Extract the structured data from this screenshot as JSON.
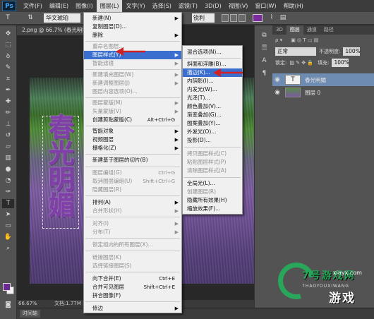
{
  "app": {
    "logo": "Ps"
  },
  "menubar": [
    "文件(F)",
    "编辑(E)",
    "图像(I)",
    "图层(L)",
    "文字(Y)",
    "选择(S)",
    "滤镜(T)",
    "3D(D)",
    "视图(V)",
    "窗口(W)",
    "帮助(H)"
  ],
  "options": {
    "font_family": "华文琥珀",
    "antialias": "锐利"
  },
  "document": {
    "tab_title": "2.png @ 66.7% (春光明媚, RGB/8) *",
    "zoom": "66.67%",
    "doc_info": "文档:1.77M",
    "canvas_text": "春光明媚"
  },
  "timeline": {
    "label": "时间轴"
  },
  "layers_panel": {
    "tabs": [
      "3D",
      "图层",
      "通道",
      "路径"
    ],
    "blend_mode": "正常",
    "opacity_label": "不透明度:",
    "opacity_value": "100%",
    "lock_label": "锁定:",
    "fill_label": "填充:",
    "fill_value": "100%",
    "layers": [
      {
        "name": "春光明媚",
        "thumb": "T"
      },
      {
        "name": "图层 0",
        "thumb": ""
      }
    ]
  },
  "layer_menu": {
    "items": [
      {
        "label": "新建(N)",
        "sub": true
      },
      {
        "label": "复制图层(D)..."
      },
      {
        "label": "删除",
        "sub": true
      },
      {
        "label": "重命名图层...",
        "disabled": true
      },
      {
        "label": "图层样式(Y)",
        "sub": true,
        "highlight": true
      },
      {
        "label": "智能滤镜",
        "sub": true,
        "disabled": true
      },
      {
        "label": "新建填充图层(W)",
        "sub": true,
        "disabled": true
      },
      {
        "label": "新建调整图层(J)",
        "sub": true,
        "disabled": true
      },
      {
        "label": "图层内容选项(O)...",
        "disabled": true
      },
      {
        "label": "图层蒙版(M)",
        "sub": true,
        "disabled": true
      },
      {
        "label": "矢量蒙版(V)",
        "sub": true,
        "disabled": true
      },
      {
        "label": "创建剪贴蒙版(C)",
        "shortcut": "Alt+Ctrl+G"
      },
      {
        "label": "智能对象",
        "sub": true
      },
      {
        "label": "视频图层",
        "sub": true
      },
      {
        "label": "栅格化(Z)",
        "sub": true
      },
      {
        "label": "新建基于图层的切片(B)"
      },
      {
        "label": "图层编组(G)",
        "shortcut": "Ctrl+G",
        "disabled": true
      },
      {
        "label": "取消图层编组(U)",
        "shortcut": "Shift+Ctrl+G",
        "disabled": true
      },
      {
        "label": "隐藏图层(R)",
        "disabled": true
      },
      {
        "label": "排列(A)",
        "sub": true
      },
      {
        "label": "合并形状(H)",
        "sub": true,
        "disabled": true
      },
      {
        "label": "对齐(I)",
        "sub": true,
        "disabled": true
      },
      {
        "label": "分布(T)",
        "sub": true,
        "disabled": true
      },
      {
        "label": "锁定组内的所有图层(X)...",
        "disabled": true
      },
      {
        "label": "链接图层(K)",
        "disabled": true
      },
      {
        "label": "选择链接图层(S)",
        "disabled": true
      },
      {
        "label": "向下合并(E)",
        "shortcut": "Ctrl+E"
      },
      {
        "label": "合并可见图层",
        "shortcut": "Shift+Ctrl+E"
      },
      {
        "label": "拼合图像(F)"
      },
      {
        "label": "修边",
        "sub": true
      }
    ]
  },
  "style_menu": {
    "items": [
      {
        "label": "混合选项(N)..."
      },
      {
        "label": "斜面和浮雕(B)..."
      },
      {
        "label": "描边(K)...",
        "highlight": true
      },
      {
        "label": "内阴影(I)..."
      },
      {
        "label": "内发光(W)..."
      },
      {
        "label": "光泽(T)..."
      },
      {
        "label": "颜色叠加(V)..."
      },
      {
        "label": "渐变叠加(G)..."
      },
      {
        "label": "图案叠加(Y)..."
      },
      {
        "label": "外发光(O)..."
      },
      {
        "label": "投影(D)..."
      },
      {
        "label": "拷贝图层样式(C)",
        "disabled": true
      },
      {
        "label": "粘贴图层样式(P)",
        "disabled": true
      },
      {
        "label": "清除图层样式(A)",
        "disabled": true
      },
      {
        "label": "全局光(L)..."
      },
      {
        "label": "创建图层(R)",
        "disabled": true
      },
      {
        "label": "隐藏所有效果(H)"
      },
      {
        "label": "缩放效果(F)..."
      }
    ]
  },
  "watermark": {
    "title": "7号游戏网",
    "url": "xiayx.com",
    "sub": "7HAOYOUXIWANG",
    "brand": "游戏"
  },
  "colors": {
    "menu_highlight": "#3a6fd0",
    "text_purple": "#7f3ea8",
    "arrow_red": "#d42020",
    "watermark_green": "#28a65a"
  }
}
